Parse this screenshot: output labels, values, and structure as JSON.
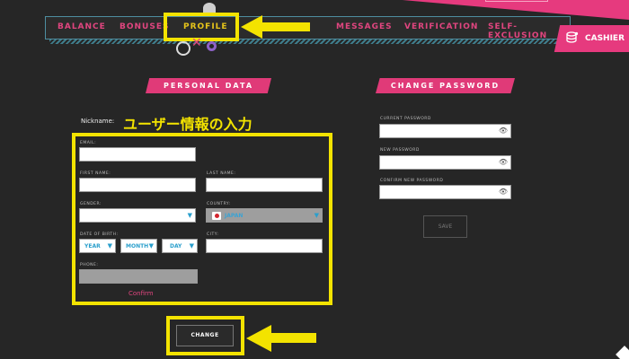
{
  "nav": {
    "items": [
      "BALANCE",
      "BONUSES",
      "PROFILE",
      "MESSAGES",
      "VERIFICATION",
      "SELF-EXCLUSION"
    ],
    "active": "PROFILE"
  },
  "cashier": {
    "label": "CASHIER",
    "icon": "coins-icon"
  },
  "personal": {
    "header": "PERSONAL DATA",
    "nickname_label": "Nickname:",
    "annotation": "ユーザー情報の入力",
    "email_label": "EMAIL:",
    "first_name_label": "FIRST NAME:",
    "last_name_label": "LAST NAME:",
    "gender_label": "GENDER:",
    "country_label": "COUNTRY:",
    "country_value": "JAPAN",
    "dob_label": "DATE OF BIRTH:",
    "year": "YEAR",
    "month": "MONTH",
    "day": "DAY",
    "city_label": "CITY:",
    "phone_label": "PHONE:",
    "confirm": "Confirm",
    "change_button": "CHANGE"
  },
  "password": {
    "header": "CHANGE PASSWORD",
    "current_label": "CURRENT PASSWORD",
    "new_label": "NEW PASSWORD",
    "confirm_label": "CONFIRM NEW PASSWORD",
    "save_button": "SAVE"
  },
  "colors": {
    "background": "#262626",
    "accent_pink": "#e03a78",
    "highlight_yellow": "#f3e300",
    "nav_border": "#4e8ea0",
    "active_nav": "#e6c41a"
  }
}
